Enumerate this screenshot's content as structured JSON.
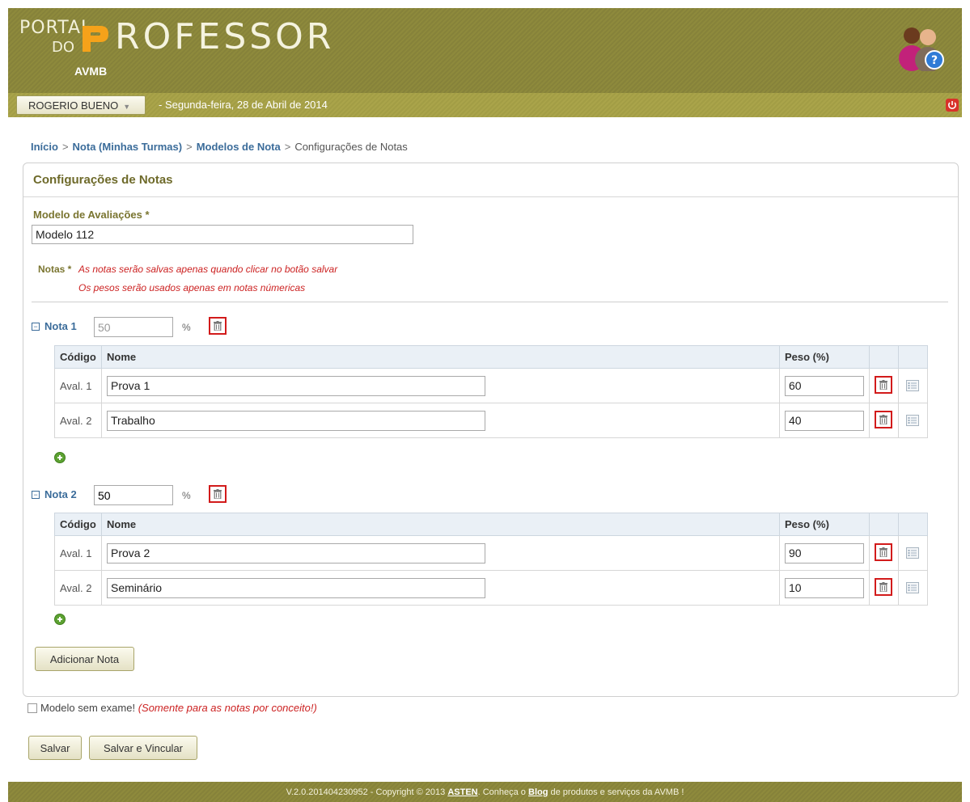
{
  "header": {
    "logo_portal": "PORTAL",
    "logo_do": "DO",
    "logo_professor": "ROFESSOR",
    "logo_org": "AVMB",
    "user_name": "ROGERIO BUENO",
    "date": "-  Segunda-feira, 28 de Abril de 2014"
  },
  "breadcrumb": {
    "items": [
      "Início",
      "Nota (Minhas Turmas)",
      "Modelos de Nota"
    ],
    "current": "Configurações de Notas",
    "separator": ">"
  },
  "panel": {
    "title": "Configurações de Notas",
    "model_label": "Modelo de Avaliações *",
    "model_value": "Modelo 112",
    "notes_label": "Notas *",
    "notes_msg1": "As notas serão salvas apenas quando clicar no botão salvar",
    "notes_msg2": "Os pesos serão usados apenas em notas númericas"
  },
  "columns": {
    "codigo": "Código",
    "nome": "Nome",
    "peso": "Peso (%)"
  },
  "notas": [
    {
      "name": "Nota 1",
      "percent": "50",
      "percent_unit": "%",
      "rows": [
        {
          "code": "Aval. 1",
          "name": "Prova 1",
          "peso": "60"
        },
        {
          "code": "Aval. 2",
          "name": "Trabalho",
          "peso": "40"
        }
      ]
    },
    {
      "name": "Nota 2",
      "percent": "50",
      "percent_unit": "%",
      "rows": [
        {
          "code": "Aval. 1",
          "name": "Prova 2",
          "peso": "90"
        },
        {
          "code": "Aval. 2",
          "name": "Seminário",
          "peso": "10"
        }
      ]
    }
  ],
  "buttons": {
    "add_nota": "Adicionar Nota",
    "save": "Salvar",
    "save_link": "Salvar e Vincular"
  },
  "checkbox": {
    "label": "Modelo sem exame!",
    "note": "(Somente para as notas por conceito!)"
  },
  "footer": {
    "prefix": "V.2.0.201404230952 - Copyright © 2013",
    "asten": "ASTEN",
    "mid": ". Conheça o",
    "blog": "Blog",
    "suffix": "de produtos e serviços da AVMB !"
  },
  "colors": {
    "header_olive": "#8e8a3c",
    "link_blue": "#3b6c9a",
    "warning_red": "#cc2222",
    "trash_highlight": "#d21b1b",
    "add_green": "#5da232"
  }
}
